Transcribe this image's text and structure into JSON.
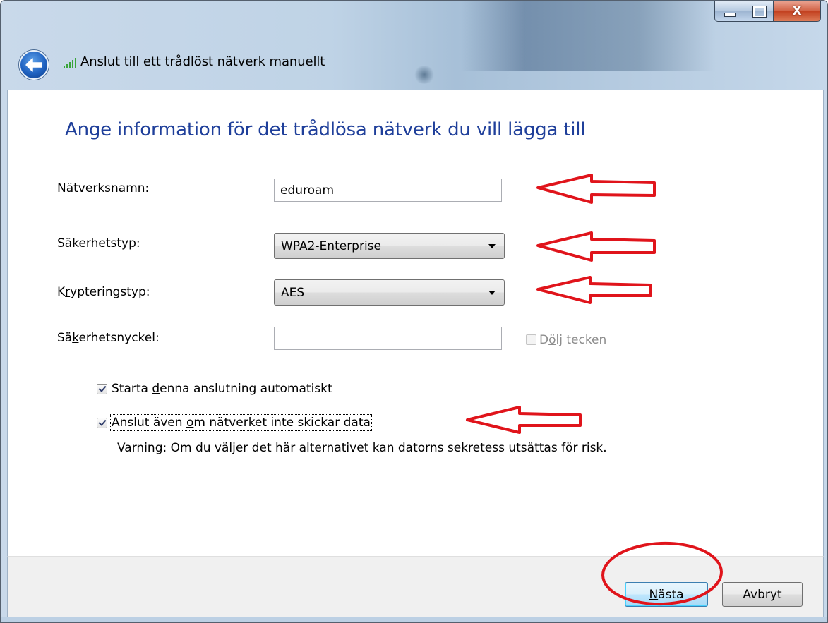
{
  "window": {
    "title": "Anslut till ett trådlöst nätverk manuellt",
    "close_glyph": "X"
  },
  "heading": "Ange information för det trådlösa nätverk du vill lägga till",
  "form": {
    "network_name": {
      "label_prefix": "N",
      "label_accel": "ä",
      "label_suffix": "tverksnamn:",
      "value": "eduroam"
    },
    "security_type": {
      "label_prefix": "",
      "label_accel": "S",
      "label_suffix": "äkerhetstyp:",
      "value": "WPA2-Enterprise"
    },
    "encryption_type": {
      "label_prefix": "K",
      "label_accel": "r",
      "label_suffix": "ypteringstyp:",
      "value": "AES"
    },
    "security_key": {
      "label_prefix": "Sä",
      "label_accel": "k",
      "label_suffix": "erhetsnyckel:",
      "value": ""
    },
    "hide_chars": {
      "label_prefix": "D",
      "label_accel": "ö",
      "label_suffix": "lj tecken",
      "checked": false,
      "enabled": false
    }
  },
  "options": {
    "auto_start": {
      "label_prefix": "Starta ",
      "label_accel": "d",
      "label_suffix": "enna anslutning automatiskt",
      "checked": true
    },
    "connect_even": {
      "label_prefix": "Anslut även ",
      "label_accel": "o",
      "label_suffix": "m nätverket inte skickar data",
      "checked": true
    }
  },
  "warning": "Varning: Om du väljer det här alternativet kan datorns sekretess utsättas för risk.",
  "buttons": {
    "next": {
      "accel": "N",
      "rest": "ästa"
    },
    "cancel": "Avbryt"
  },
  "colors": {
    "heading": "#1f3f9a",
    "annotation": "#e0141b",
    "signal_icon": "#3aa53a"
  }
}
